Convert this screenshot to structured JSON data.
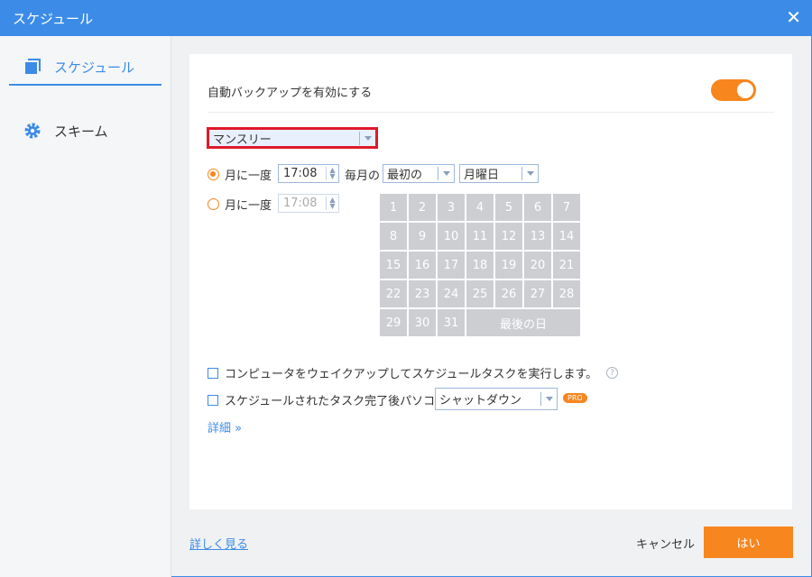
{
  "window": {
    "title": "スケジュール"
  },
  "sidebar": {
    "items": [
      {
        "label": "スケジュール"
      },
      {
        "label": "スキーム"
      }
    ]
  },
  "main": {
    "enable_label": "自動バックアップを有効にする",
    "enable_on": true,
    "frequency": "マンスリー",
    "option1": {
      "label": "月に一度",
      "time": "17:08",
      "every_month": "毎月の",
      "ordinal": "最初の",
      "weekday": "月曜日",
      "selected": true
    },
    "option2": {
      "label": "月に一度",
      "time": "17:08",
      "selected": false
    },
    "days": [
      "1",
      "2",
      "3",
      "4",
      "5",
      "6",
      "7",
      "8",
      "9",
      "10",
      "11",
      "12",
      "13",
      "14",
      "15",
      "16",
      "17",
      "18",
      "19",
      "20",
      "21",
      "22",
      "23",
      "24",
      "25",
      "26",
      "27",
      "28",
      "29",
      "30",
      "31"
    ],
    "last_day": "最後の日",
    "wake_label": "コンピュータをウェイクアップしてスケジュールタスクを実行します。",
    "after_label": "スケジュールされたタスク完了後パソコン",
    "after_action": "シャットダウン",
    "pro_badge": "PRO",
    "details": "詳細"
  },
  "footer": {
    "learn_more": "詳しく見る",
    "cancel": "キャンセル",
    "ok": "はい"
  }
}
